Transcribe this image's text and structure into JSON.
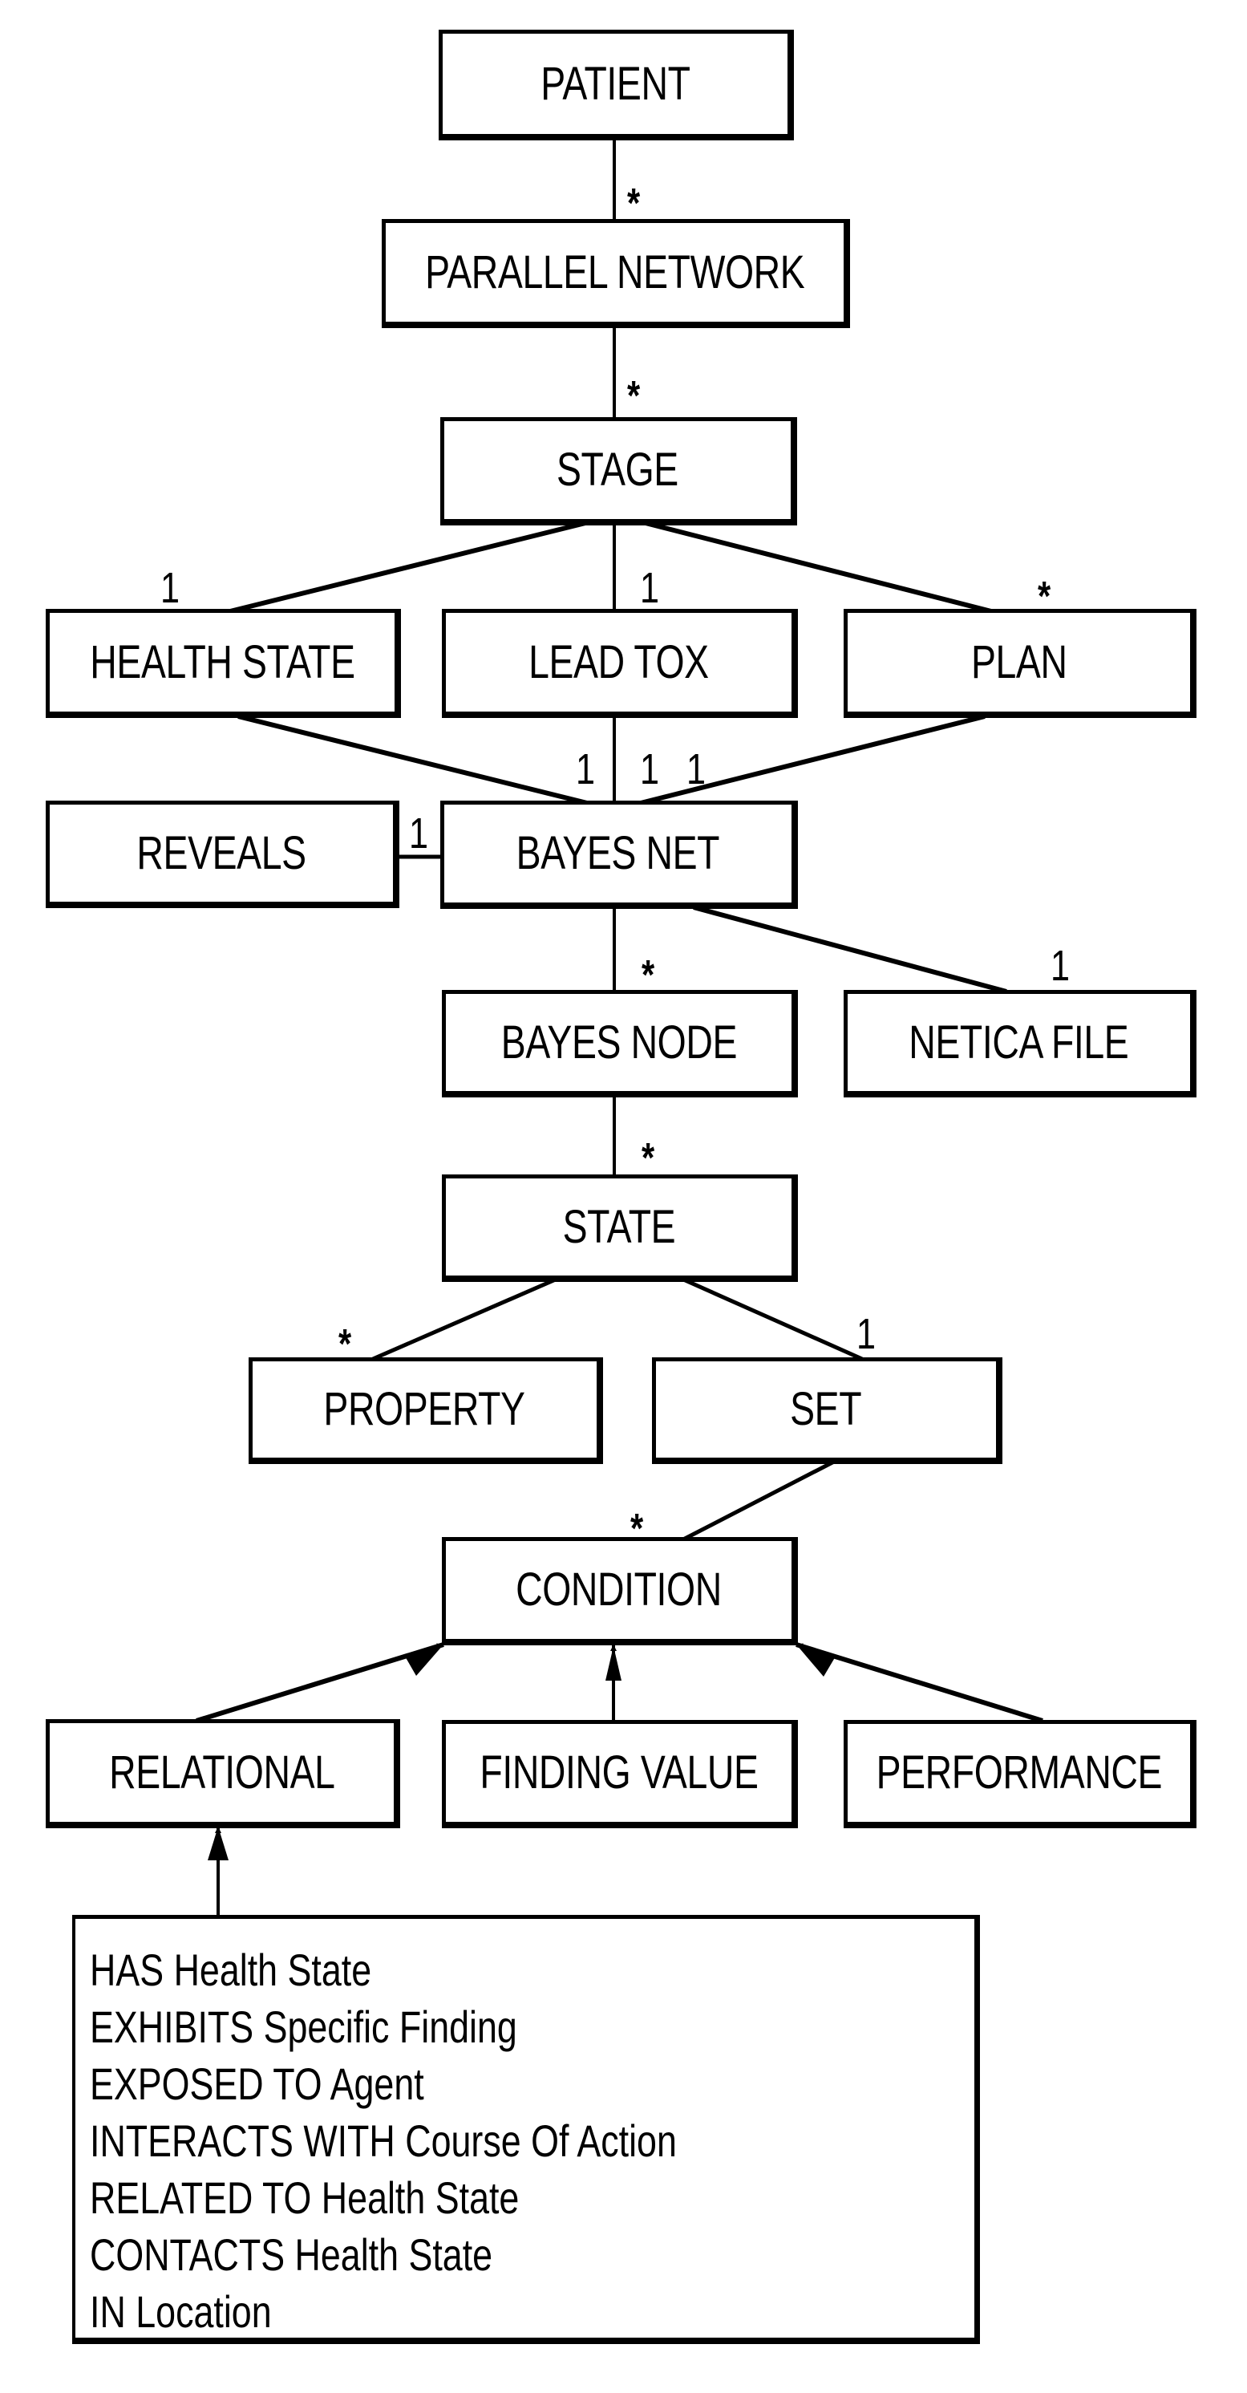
{
  "diagram": {
    "type": "class-diagram",
    "nodes": {
      "patient": "PATIENT",
      "parallel_network": "PARALLEL NETWORK",
      "stage": "STAGE",
      "health_state": "HEALTH STATE",
      "lead_tox": "LEAD TOX",
      "plan": "PLAN",
      "reveals": "REVEALS",
      "bayes_net": "BAYES NET",
      "bayes_node": "BAYES NODE",
      "netica_file": "NETICA FILE",
      "state": "STATE",
      "property": "PROPERTY",
      "set": "SET",
      "condition": "CONDITION",
      "relational": "RELATIONAL",
      "finding_value": "FINDING VALUE",
      "performance": "PERFORMANCE"
    },
    "multiplicities": {
      "patient_parallel_network": "*",
      "parallel_network_stage": "*",
      "stage_health_state": "1",
      "stage_lead_tox": "1",
      "stage_plan": "*",
      "health_state_bayes_net": "1",
      "lead_tox_bayes_net": "1",
      "plan_bayes_net": "1",
      "reveals_bayes_net": "1",
      "bayes_net_bayes_node": "*",
      "bayes_net_netica_file": "1",
      "bayes_node_state": "*",
      "state_property": "*",
      "state_set": "1",
      "set_condition": "*"
    },
    "relations": [
      "HAS Health State",
      "EXHIBITS Specific Finding",
      "EXPOSED TO Agent",
      "INTERACTS WITH Course Of Action",
      "RELATED TO Health State",
      "CONTACTS Health State",
      "IN Location"
    ]
  }
}
